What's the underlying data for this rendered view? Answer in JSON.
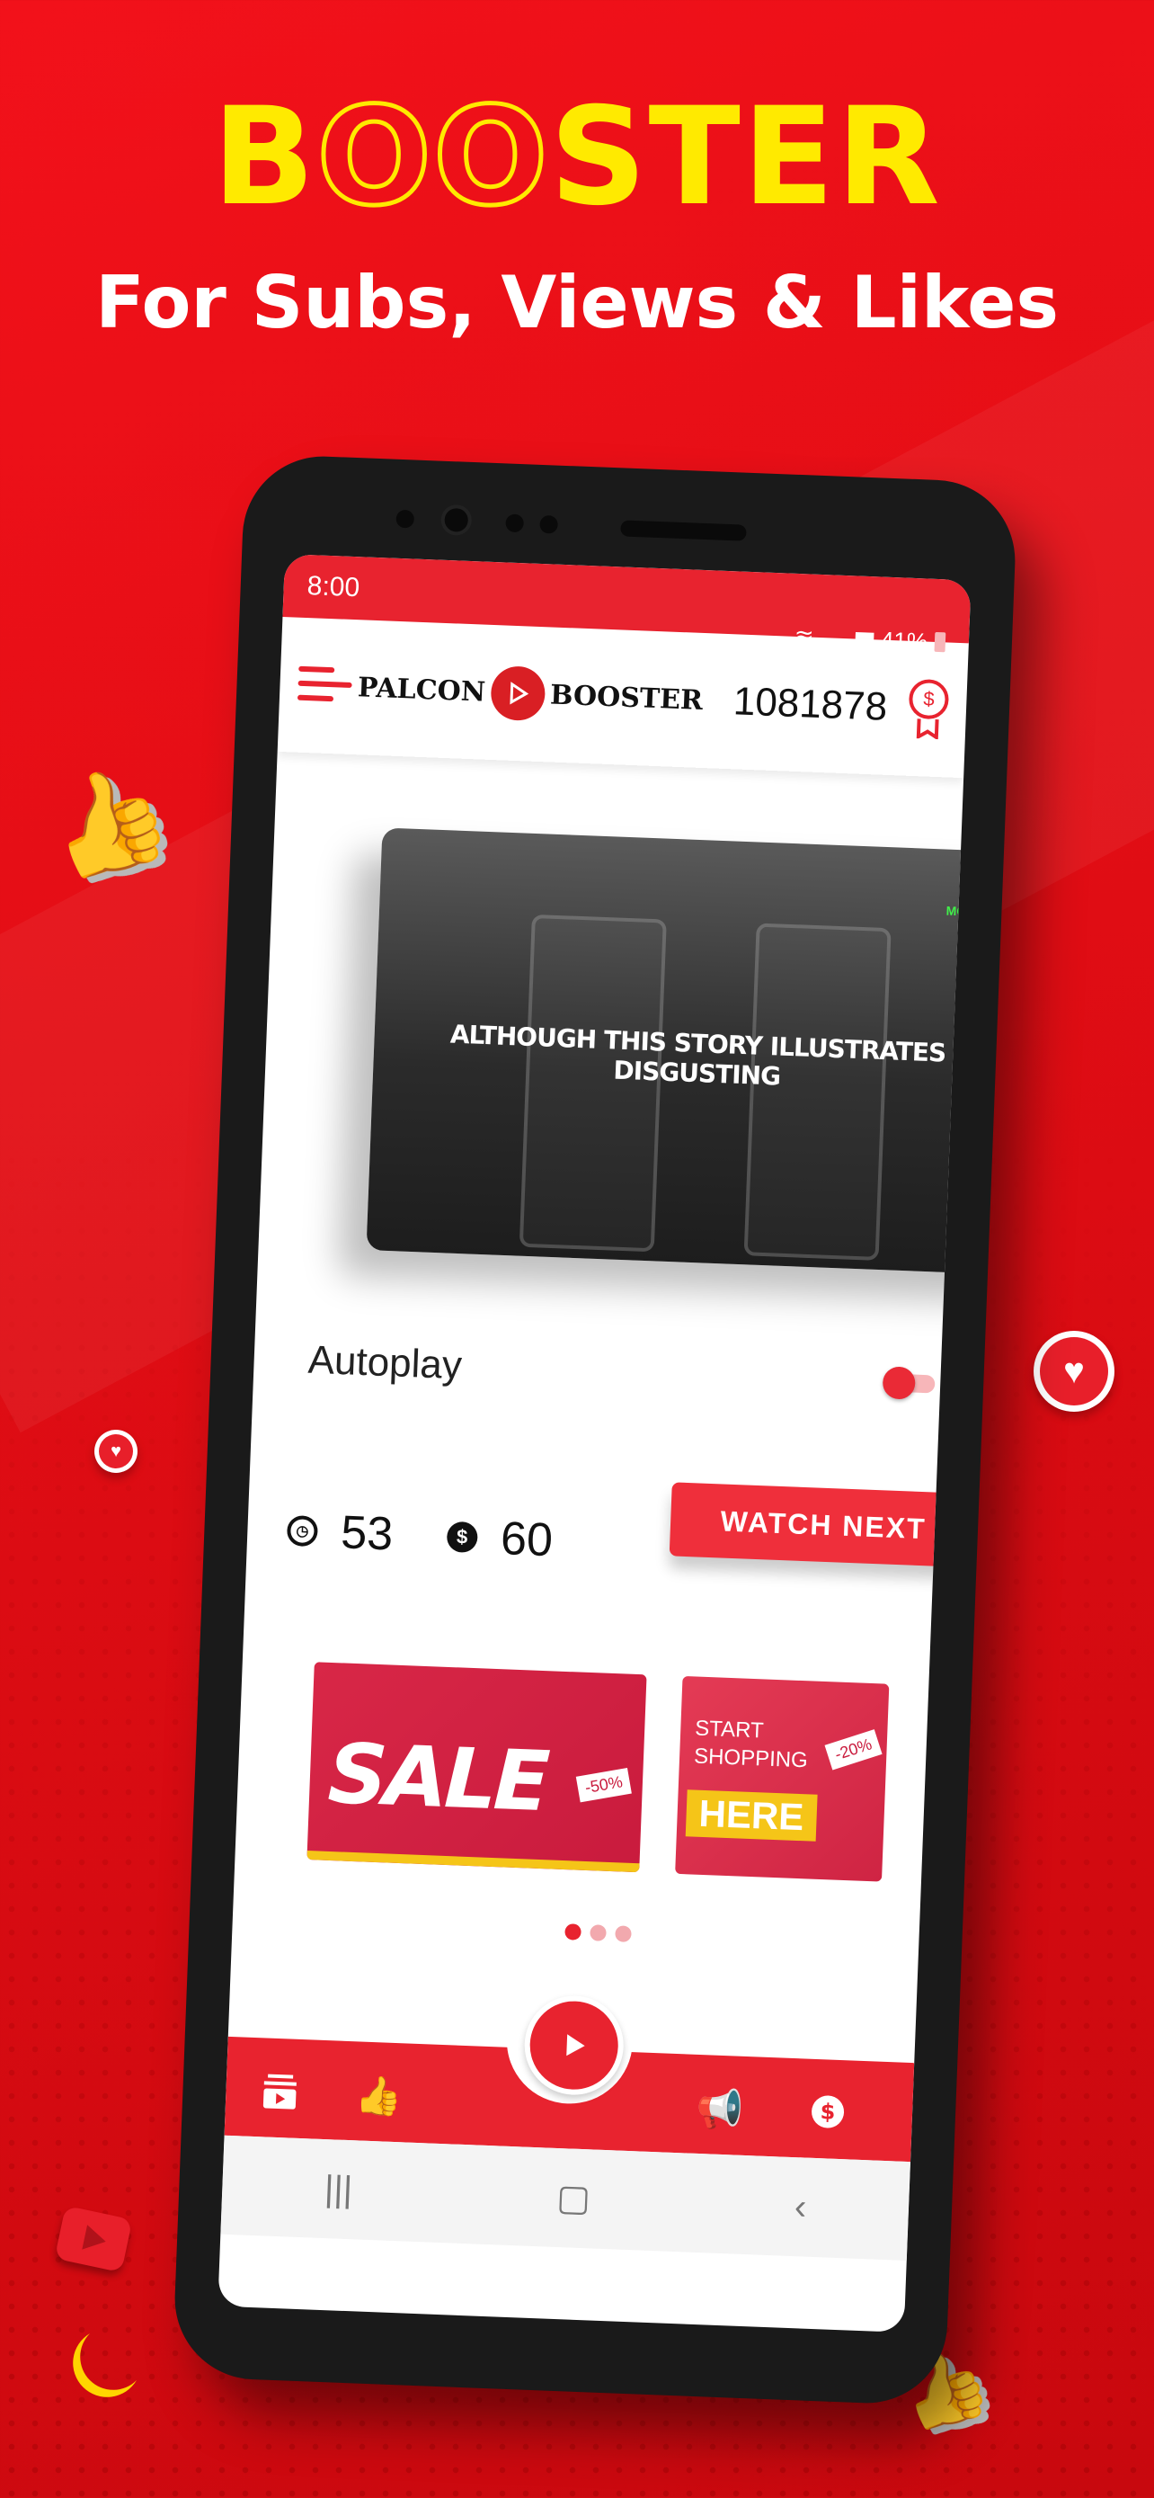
{
  "promo": {
    "headline_prefix": "B",
    "headline_o1": "O",
    "headline_o2": "O",
    "headline_suffix": "STER",
    "subline": "For Subs, Views & Likes"
  },
  "status_bar": {
    "time": "8:00",
    "battery": "41%"
  },
  "app_bar": {
    "logo_left": "PALCON",
    "logo_right": "BOOSTER",
    "coin_balance": "1081878",
    "badge_symbol": "$"
  },
  "video": {
    "caption": "ALTHOUGH THIS STORY ILLUSTRATES DISGUSTING",
    "watermark": "MOTIVATION"
  },
  "autoplay": {
    "label": "Autoplay",
    "enabled": false
  },
  "stats": {
    "seconds": "53",
    "coins": "60"
  },
  "watch_next": {
    "label": "WATCH NEXT"
  },
  "banners": [
    {
      "title": "SALE",
      "tag": "-50%"
    },
    {
      "line1": "START",
      "line2": "SHOPPING",
      "highlight": "HERE",
      "tag": "-20%"
    }
  ],
  "carousel": {
    "pages": 3,
    "active": 0
  },
  "bottom_nav": {
    "items": [
      "subscriptions-icon",
      "like-icon",
      "play-icon",
      "megaphone-icon",
      "dollar-icon"
    ]
  },
  "colors": {
    "brand_red": "#e8232f",
    "headline_yellow": "#ffea00"
  }
}
